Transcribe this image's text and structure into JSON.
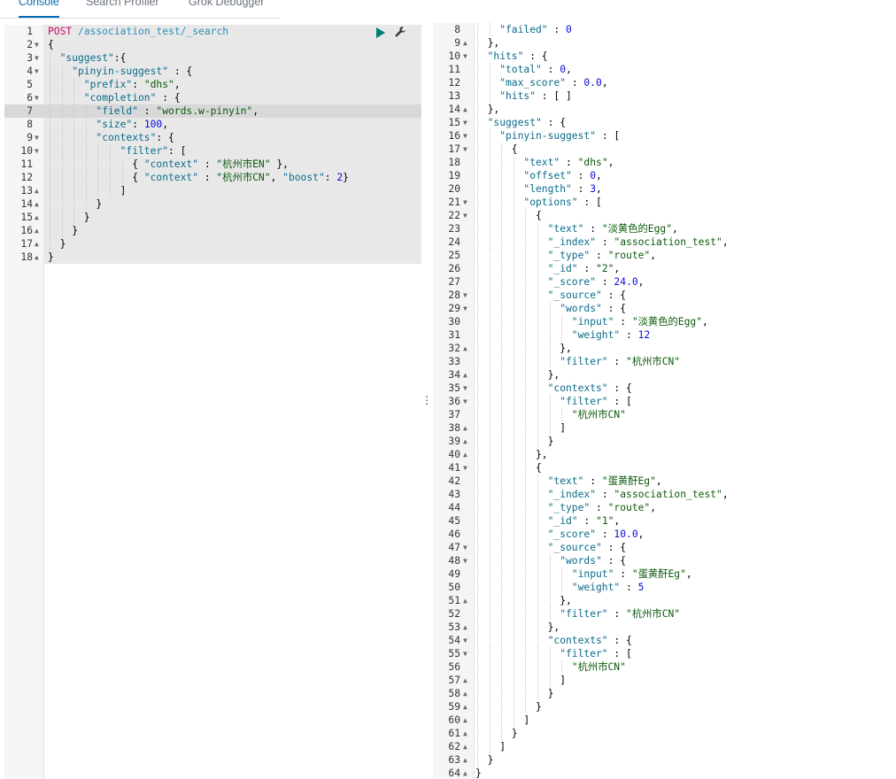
{
  "tabs": [
    "Console",
    "Search Profiler",
    "Grok Debugger"
  ],
  "request": {
    "lines": [
      {
        "n": "1",
        "fold": "",
        "indent": 0,
        "tokens": [
          [
            "method",
            "POST"
          ],
          [
            "url",
            " /association_test/_search"
          ]
        ]
      },
      {
        "n": "2",
        "fold": "▼",
        "indent": 0,
        "tokens": [
          [
            "punc",
            "{"
          ]
        ]
      },
      {
        "n": "3",
        "fold": "▼",
        "indent": 1,
        "tokens": [
          [
            "key",
            "\"suggest\""
          ],
          [
            "punc",
            ":{"
          ]
        ]
      },
      {
        "n": "4",
        "fold": "▼",
        "indent": 2,
        "tokens": [
          [
            "key",
            "\"pinyin-suggest\""
          ],
          [
            "punc",
            " : {"
          ]
        ]
      },
      {
        "n": "5",
        "fold": "",
        "indent": 3,
        "tokens": [
          [
            "key",
            "\"prefix\""
          ],
          [
            "punc",
            ": "
          ],
          [
            "str",
            "\"dhs\""
          ],
          [
            "punc",
            ","
          ]
        ]
      },
      {
        "n": "6",
        "fold": "▼",
        "indent": 3,
        "tokens": [
          [
            "key",
            "\"completion\""
          ],
          [
            "punc",
            " : {"
          ]
        ]
      },
      {
        "n": "7",
        "fold": "",
        "indent": 4,
        "tokens": [
          [
            "key",
            "\"field\""
          ],
          [
            "punc",
            " : "
          ],
          [
            "str",
            "\"words.w-pinyin\""
          ],
          [
            "punc",
            ","
          ]
        ]
      },
      {
        "n": "8",
        "fold": "",
        "indent": 4,
        "tokens": [
          [
            "key",
            "\"size\""
          ],
          [
            "punc",
            ": "
          ],
          [
            "num",
            "100"
          ],
          [
            "punc",
            ","
          ]
        ]
      },
      {
        "n": "9",
        "fold": "▼",
        "indent": 4,
        "tokens": [
          [
            "key",
            "\"contexts\""
          ],
          [
            "punc",
            ": {"
          ]
        ]
      },
      {
        "n": "10",
        "fold": "▼",
        "indent": 6,
        "tokens": [
          [
            "key",
            "\"filter\""
          ],
          [
            "punc",
            ": ["
          ]
        ]
      },
      {
        "n": "11",
        "fold": "",
        "indent": 7,
        "tokens": [
          [
            "punc",
            "{ "
          ],
          [
            "key",
            "\"context\""
          ],
          [
            "punc",
            " : "
          ],
          [
            "str",
            "\"杭州市EN\""
          ],
          [
            "punc",
            " },"
          ]
        ]
      },
      {
        "n": "12",
        "fold": "",
        "indent": 7,
        "tokens": [
          [
            "punc",
            "{ "
          ],
          [
            "key",
            "\"context\""
          ],
          [
            "punc",
            " : "
          ],
          [
            "str",
            "\"杭州市CN\""
          ],
          [
            "punc",
            ", "
          ],
          [
            "key",
            "\"boost\""
          ],
          [
            "punc",
            ": "
          ],
          [
            "num",
            "2"
          ],
          [
            "punc",
            "}"
          ]
        ]
      },
      {
        "n": "13",
        "fold": "▲",
        "indent": 6,
        "tokens": [
          [
            "punc",
            "]"
          ]
        ]
      },
      {
        "n": "14",
        "fold": "▲",
        "indent": 4,
        "tokens": [
          [
            "punc",
            "}"
          ]
        ]
      },
      {
        "n": "15",
        "fold": "▲",
        "indent": 3,
        "tokens": [
          [
            "punc",
            "}"
          ]
        ]
      },
      {
        "n": "16",
        "fold": "▲",
        "indent": 2,
        "tokens": [
          [
            "punc",
            "}"
          ]
        ]
      },
      {
        "n": "17",
        "fold": "▲",
        "indent": 1,
        "tokens": [
          [
            "punc",
            "}"
          ]
        ]
      },
      {
        "n": "18",
        "fold": "▲",
        "indent": 0,
        "tokens": [
          [
            "punc",
            "}"
          ]
        ]
      }
    ]
  },
  "response": {
    "lines": [
      {
        "n": "8",
        "fold": "",
        "indent": 2,
        "tokens": [
          [
            "key",
            "\"failed\""
          ],
          [
            "punc",
            " : "
          ],
          [
            "num",
            "0"
          ]
        ]
      },
      {
        "n": "9",
        "fold": "▲",
        "indent": 1,
        "tokens": [
          [
            "punc",
            "},"
          ]
        ]
      },
      {
        "n": "10",
        "fold": "▼",
        "indent": 1,
        "tokens": [
          [
            "key",
            "\"hits\""
          ],
          [
            "punc",
            " : {"
          ]
        ]
      },
      {
        "n": "11",
        "fold": "",
        "indent": 2,
        "tokens": [
          [
            "key",
            "\"total\""
          ],
          [
            "punc",
            " : "
          ],
          [
            "num",
            "0"
          ],
          [
            "punc",
            ","
          ]
        ]
      },
      {
        "n": "12",
        "fold": "",
        "indent": 2,
        "tokens": [
          [
            "key",
            "\"max_score\""
          ],
          [
            "punc",
            " : "
          ],
          [
            "num",
            "0.0"
          ],
          [
            "punc",
            ","
          ]
        ]
      },
      {
        "n": "13",
        "fold": "",
        "indent": 2,
        "tokens": [
          [
            "key",
            "\"hits\""
          ],
          [
            "punc",
            " : [ ]"
          ]
        ]
      },
      {
        "n": "14",
        "fold": "▲",
        "indent": 1,
        "tokens": [
          [
            "punc",
            "},"
          ]
        ]
      },
      {
        "n": "15",
        "fold": "▼",
        "indent": 1,
        "tokens": [
          [
            "key",
            "\"suggest\""
          ],
          [
            "punc",
            " : {"
          ]
        ]
      },
      {
        "n": "16",
        "fold": "▼",
        "indent": 2,
        "tokens": [
          [
            "key",
            "\"pinyin-suggest\""
          ],
          [
            "punc",
            " : ["
          ]
        ]
      },
      {
        "n": "17",
        "fold": "▼",
        "indent": 3,
        "tokens": [
          [
            "punc",
            "{"
          ]
        ]
      },
      {
        "n": "18",
        "fold": "",
        "indent": 4,
        "tokens": [
          [
            "key",
            "\"text\""
          ],
          [
            "punc",
            " : "
          ],
          [
            "str",
            "\"dhs\""
          ],
          [
            "punc",
            ","
          ]
        ]
      },
      {
        "n": "19",
        "fold": "",
        "indent": 4,
        "tokens": [
          [
            "key",
            "\"offset\""
          ],
          [
            "punc",
            " : "
          ],
          [
            "num",
            "0"
          ],
          [
            "punc",
            ","
          ]
        ]
      },
      {
        "n": "20",
        "fold": "",
        "indent": 4,
        "tokens": [
          [
            "key",
            "\"length\""
          ],
          [
            "punc",
            " : "
          ],
          [
            "num",
            "3"
          ],
          [
            "punc",
            ","
          ]
        ]
      },
      {
        "n": "21",
        "fold": "▼",
        "indent": 4,
        "tokens": [
          [
            "key",
            "\"options\""
          ],
          [
            "punc",
            " : ["
          ]
        ]
      },
      {
        "n": "22",
        "fold": "▼",
        "indent": 5,
        "tokens": [
          [
            "punc",
            "{"
          ]
        ]
      },
      {
        "n": "23",
        "fold": "",
        "indent": 6,
        "tokens": [
          [
            "key",
            "\"text\""
          ],
          [
            "punc",
            " : "
          ],
          [
            "str",
            "\"淡黄色的Egg\""
          ],
          [
            "punc",
            ","
          ]
        ]
      },
      {
        "n": "24",
        "fold": "",
        "indent": 6,
        "tokens": [
          [
            "key",
            "\"_index\""
          ],
          [
            "punc",
            " : "
          ],
          [
            "str",
            "\"association_test\""
          ],
          [
            "punc",
            ","
          ]
        ]
      },
      {
        "n": "25",
        "fold": "",
        "indent": 6,
        "tokens": [
          [
            "key",
            "\"_type\""
          ],
          [
            "punc",
            " : "
          ],
          [
            "str",
            "\"route\""
          ],
          [
            "punc",
            ","
          ]
        ]
      },
      {
        "n": "26",
        "fold": "",
        "indent": 6,
        "tokens": [
          [
            "key",
            "\"_id\""
          ],
          [
            "punc",
            " : "
          ],
          [
            "str",
            "\"2\""
          ],
          [
            "punc",
            ","
          ]
        ]
      },
      {
        "n": "27",
        "fold": "",
        "indent": 6,
        "tokens": [
          [
            "key",
            "\"_score\""
          ],
          [
            "punc",
            " : "
          ],
          [
            "num",
            "24.0"
          ],
          [
            "punc",
            ","
          ]
        ]
      },
      {
        "n": "28",
        "fold": "▼",
        "indent": 6,
        "tokens": [
          [
            "key",
            "\"_source\""
          ],
          [
            "punc",
            " : {"
          ]
        ]
      },
      {
        "n": "29",
        "fold": "▼",
        "indent": 7,
        "tokens": [
          [
            "key",
            "\"words\""
          ],
          [
            "punc",
            " : {"
          ]
        ]
      },
      {
        "n": "30",
        "fold": "",
        "indent": 8,
        "tokens": [
          [
            "key",
            "\"input\""
          ],
          [
            "punc",
            " : "
          ],
          [
            "str",
            "\"淡黄色的Egg\""
          ],
          [
            "punc",
            ","
          ]
        ]
      },
      {
        "n": "31",
        "fold": "",
        "indent": 8,
        "tokens": [
          [
            "key",
            "\"weight\""
          ],
          [
            "punc",
            " : "
          ],
          [
            "num",
            "12"
          ]
        ]
      },
      {
        "n": "32",
        "fold": "▲",
        "indent": 7,
        "tokens": [
          [
            "punc",
            "},"
          ]
        ]
      },
      {
        "n": "33",
        "fold": "",
        "indent": 7,
        "tokens": [
          [
            "key",
            "\"filter\""
          ],
          [
            "punc",
            " : "
          ],
          [
            "str",
            "\"杭州市CN\""
          ]
        ]
      },
      {
        "n": "34",
        "fold": "▲",
        "indent": 6,
        "tokens": [
          [
            "punc",
            "},"
          ]
        ]
      },
      {
        "n": "35",
        "fold": "▼",
        "indent": 6,
        "tokens": [
          [
            "key",
            "\"contexts\""
          ],
          [
            "punc",
            " : {"
          ]
        ]
      },
      {
        "n": "36",
        "fold": "▼",
        "indent": 7,
        "tokens": [
          [
            "key",
            "\"filter\""
          ],
          [
            "punc",
            " : ["
          ]
        ]
      },
      {
        "n": "37",
        "fold": "",
        "indent": 8,
        "tokens": [
          [
            "str",
            "\"杭州市CN\""
          ]
        ]
      },
      {
        "n": "38",
        "fold": "▲",
        "indent": 7,
        "tokens": [
          [
            "punc",
            "]"
          ]
        ]
      },
      {
        "n": "39",
        "fold": "▲",
        "indent": 6,
        "tokens": [
          [
            "punc",
            "}"
          ]
        ]
      },
      {
        "n": "40",
        "fold": "▲",
        "indent": 5,
        "tokens": [
          [
            "punc",
            "},"
          ]
        ]
      },
      {
        "n": "41",
        "fold": "▼",
        "indent": 5,
        "tokens": [
          [
            "punc",
            "{"
          ]
        ]
      },
      {
        "n": "42",
        "fold": "",
        "indent": 6,
        "tokens": [
          [
            "key",
            "\"text\""
          ],
          [
            "punc",
            " : "
          ],
          [
            "str",
            "\"蛋黄酐Eg\""
          ],
          [
            "punc",
            ","
          ]
        ]
      },
      {
        "n": "43",
        "fold": "",
        "indent": 6,
        "tokens": [
          [
            "key",
            "\"_index\""
          ],
          [
            "punc",
            " : "
          ],
          [
            "str",
            "\"association_test\""
          ],
          [
            "punc",
            ","
          ]
        ]
      },
      {
        "n": "44",
        "fold": "",
        "indent": 6,
        "tokens": [
          [
            "key",
            "\"_type\""
          ],
          [
            "punc",
            " : "
          ],
          [
            "str",
            "\"route\""
          ],
          [
            "punc",
            ","
          ]
        ]
      },
      {
        "n": "45",
        "fold": "",
        "indent": 6,
        "tokens": [
          [
            "key",
            "\"_id\""
          ],
          [
            "punc",
            " : "
          ],
          [
            "str",
            "\"1\""
          ],
          [
            "punc",
            ","
          ]
        ]
      },
      {
        "n": "46",
        "fold": "",
        "indent": 6,
        "tokens": [
          [
            "key",
            "\"_score\""
          ],
          [
            "punc",
            " : "
          ],
          [
            "num",
            "10.0"
          ],
          [
            "punc",
            ","
          ]
        ]
      },
      {
        "n": "47",
        "fold": "▼",
        "indent": 6,
        "tokens": [
          [
            "key",
            "\"_source\""
          ],
          [
            "punc",
            " : {"
          ]
        ]
      },
      {
        "n": "48",
        "fold": "▼",
        "indent": 7,
        "tokens": [
          [
            "key",
            "\"words\""
          ],
          [
            "punc",
            " : {"
          ]
        ]
      },
      {
        "n": "49",
        "fold": "",
        "indent": 8,
        "tokens": [
          [
            "key",
            "\"input\""
          ],
          [
            "punc",
            " : "
          ],
          [
            "str",
            "\"蛋黄酐Eg\""
          ],
          [
            "punc",
            ","
          ]
        ]
      },
      {
        "n": "50",
        "fold": "",
        "indent": 8,
        "tokens": [
          [
            "key",
            "\"weight\""
          ],
          [
            "punc",
            " : "
          ],
          [
            "num",
            "5"
          ]
        ]
      },
      {
        "n": "51",
        "fold": "▲",
        "indent": 7,
        "tokens": [
          [
            "punc",
            "},"
          ]
        ]
      },
      {
        "n": "52",
        "fold": "",
        "indent": 7,
        "tokens": [
          [
            "key",
            "\"filter\""
          ],
          [
            "punc",
            " : "
          ],
          [
            "str",
            "\"杭州市CN\""
          ]
        ]
      },
      {
        "n": "53",
        "fold": "▲",
        "indent": 6,
        "tokens": [
          [
            "punc",
            "},"
          ]
        ]
      },
      {
        "n": "54",
        "fold": "▼",
        "indent": 6,
        "tokens": [
          [
            "key",
            "\"contexts\""
          ],
          [
            "punc",
            " : {"
          ]
        ]
      },
      {
        "n": "55",
        "fold": "▼",
        "indent": 7,
        "tokens": [
          [
            "key",
            "\"filter\""
          ],
          [
            "punc",
            " : ["
          ]
        ]
      },
      {
        "n": "56",
        "fold": "",
        "indent": 8,
        "tokens": [
          [
            "str",
            "\"杭州市CN\""
          ]
        ]
      },
      {
        "n": "57",
        "fold": "▲",
        "indent": 7,
        "tokens": [
          [
            "punc",
            "]"
          ]
        ]
      },
      {
        "n": "58",
        "fold": "▲",
        "indent": 6,
        "tokens": [
          [
            "punc",
            "}"
          ]
        ]
      },
      {
        "n": "59",
        "fold": "▲",
        "indent": 5,
        "tokens": [
          [
            "punc",
            "}"
          ]
        ]
      },
      {
        "n": "60",
        "fold": "▲",
        "indent": 4,
        "tokens": [
          [
            "punc",
            "]"
          ]
        ]
      },
      {
        "n": "61",
        "fold": "▲",
        "indent": 3,
        "tokens": [
          [
            "punc",
            "}"
          ]
        ]
      },
      {
        "n": "62",
        "fold": "▲",
        "indent": 2,
        "tokens": [
          [
            "punc",
            "]"
          ]
        ]
      },
      {
        "n": "63",
        "fold": "▲",
        "indent": 1,
        "tokens": [
          [
            "punc",
            "}"
          ]
        ]
      },
      {
        "n": "64",
        "fold": "▲",
        "indent": 0,
        "tokens": [
          [
            "punc",
            "}"
          ]
        ]
      }
    ]
  },
  "toolbar": {
    "play_icon": "play-icon",
    "wrench_icon": "wrench-icon"
  },
  "colors": {
    "method": "#c80a68",
    "url": "#2e8fb8",
    "key": "#0a6b8a",
    "string": "#0c5a0c",
    "number": "#0c0ce0"
  }
}
